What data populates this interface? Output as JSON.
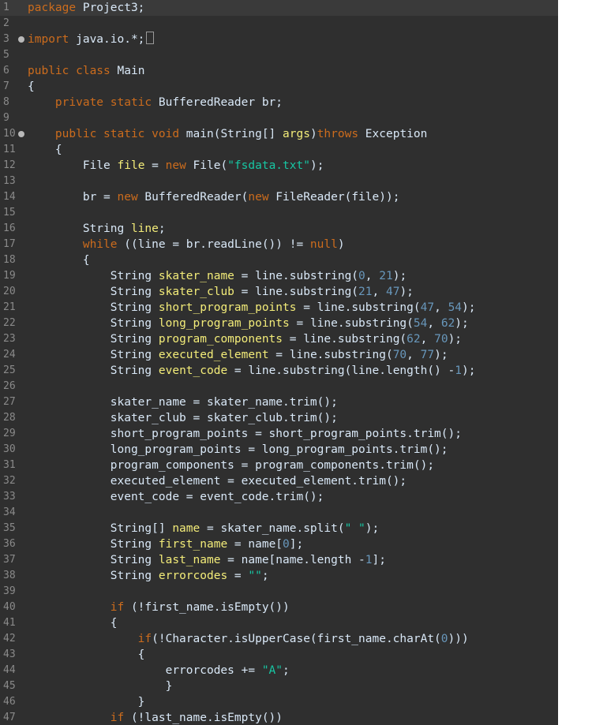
{
  "lines": [
    {
      "n": "1",
      "fold": false,
      "first": true,
      "tokens": [
        {
          "t": "package ",
          "c": "kw"
        },
        {
          "t": "Project3;",
          "c": "plain"
        }
      ]
    },
    {
      "n": "2",
      "fold": false,
      "tokens": []
    },
    {
      "n": "3",
      "fold": true,
      "tokens": [
        {
          "t": "import ",
          "c": "kw"
        },
        {
          "t": "java.io.*;",
          "c": "plain"
        }
      ],
      "box": true
    },
    {
      "n": "5",
      "fold": false,
      "tokens": []
    },
    {
      "n": "6",
      "fold": false,
      "tokens": [
        {
          "t": "public class ",
          "c": "kw"
        },
        {
          "t": "Main",
          "c": "plain"
        }
      ]
    },
    {
      "n": "7",
      "fold": false,
      "tokens": [
        {
          "t": "{",
          "c": "plain"
        }
      ]
    },
    {
      "n": "8",
      "fold": false,
      "tokens": [
        {
          "t": "    private static ",
          "c": "kw"
        },
        {
          "t": "BufferedReader br;",
          "c": "plain"
        }
      ]
    },
    {
      "n": "9",
      "fold": false,
      "tokens": []
    },
    {
      "n": "10",
      "fold": true,
      "tokens": [
        {
          "t": "    public static void ",
          "c": "kw"
        },
        {
          "t": "main",
          "c": "plain"
        },
        {
          "t": "(String[] ",
          "c": "plain"
        },
        {
          "t": "args",
          "c": "var"
        },
        {
          "t": ")",
          "c": "plain"
        },
        {
          "t": "throws ",
          "c": "kw"
        },
        {
          "t": "Exception",
          "c": "plain"
        }
      ]
    },
    {
      "n": "11",
      "fold": false,
      "tokens": [
        {
          "t": "    {",
          "c": "plain"
        }
      ]
    },
    {
      "n": "12",
      "fold": false,
      "tokens": [
        {
          "t": "        File ",
          "c": "plain"
        },
        {
          "t": "file",
          "c": "var"
        },
        {
          "t": " = ",
          "c": "plain"
        },
        {
          "t": "new ",
          "c": "kw"
        },
        {
          "t": "File(",
          "c": "plain"
        },
        {
          "t": "\"fsdata.txt\"",
          "c": "str"
        },
        {
          "t": ");",
          "c": "plain"
        }
      ]
    },
    {
      "n": "13",
      "fold": false,
      "tokens": []
    },
    {
      "n": "14",
      "fold": false,
      "tokens": [
        {
          "t": "        br = ",
          "c": "plain"
        },
        {
          "t": "new ",
          "c": "kw"
        },
        {
          "t": "BufferedReader(",
          "c": "plain"
        },
        {
          "t": "new ",
          "c": "kw"
        },
        {
          "t": "FileReader(file));",
          "c": "plain"
        }
      ]
    },
    {
      "n": "15",
      "fold": false,
      "tokens": []
    },
    {
      "n": "16",
      "fold": false,
      "tokens": [
        {
          "t": "        String ",
          "c": "plain"
        },
        {
          "t": "line",
          "c": "var"
        },
        {
          "t": ";",
          "c": "plain"
        }
      ]
    },
    {
      "n": "17",
      "fold": false,
      "tokens": [
        {
          "t": "        while ",
          "c": "kw"
        },
        {
          "t": "((line = br.readLine()) != ",
          "c": "plain"
        },
        {
          "t": "null",
          "c": "kw"
        },
        {
          "t": ")",
          "c": "plain"
        }
      ]
    },
    {
      "n": "18",
      "fold": false,
      "tokens": [
        {
          "t": "        {",
          "c": "plain"
        }
      ]
    },
    {
      "n": "19",
      "fold": false,
      "tokens": [
        {
          "t": "            String ",
          "c": "plain"
        },
        {
          "t": "skater_name",
          "c": "var"
        },
        {
          "t": " = line.substring(",
          "c": "plain"
        },
        {
          "t": "0",
          "c": "num"
        },
        {
          "t": ", ",
          "c": "plain"
        },
        {
          "t": "21",
          "c": "num"
        },
        {
          "t": ");",
          "c": "plain"
        }
      ]
    },
    {
      "n": "20",
      "fold": false,
      "tokens": [
        {
          "t": "            String ",
          "c": "plain"
        },
        {
          "t": "skater_club",
          "c": "var"
        },
        {
          "t": " = line.substring(",
          "c": "plain"
        },
        {
          "t": "21",
          "c": "num"
        },
        {
          "t": ", ",
          "c": "plain"
        },
        {
          "t": "47",
          "c": "num"
        },
        {
          "t": ");",
          "c": "plain"
        }
      ]
    },
    {
      "n": "21",
      "fold": false,
      "tokens": [
        {
          "t": "            String ",
          "c": "plain"
        },
        {
          "t": "short_program_points",
          "c": "var"
        },
        {
          "t": " = line.substring(",
          "c": "plain"
        },
        {
          "t": "47",
          "c": "num"
        },
        {
          "t": ", ",
          "c": "plain"
        },
        {
          "t": "54",
          "c": "num"
        },
        {
          "t": ");",
          "c": "plain"
        }
      ]
    },
    {
      "n": "22",
      "fold": false,
      "tokens": [
        {
          "t": "            String ",
          "c": "plain"
        },
        {
          "t": "long_program_points",
          "c": "var"
        },
        {
          "t": " = line.substring(",
          "c": "plain"
        },
        {
          "t": "54",
          "c": "num"
        },
        {
          "t": ", ",
          "c": "plain"
        },
        {
          "t": "62",
          "c": "num"
        },
        {
          "t": ");",
          "c": "plain"
        }
      ]
    },
    {
      "n": "23",
      "fold": false,
      "tokens": [
        {
          "t": "            String ",
          "c": "plain"
        },
        {
          "t": "program_components",
          "c": "var"
        },
        {
          "t": " = line.substring(",
          "c": "plain"
        },
        {
          "t": "62",
          "c": "num"
        },
        {
          "t": ", ",
          "c": "plain"
        },
        {
          "t": "70",
          "c": "num"
        },
        {
          "t": ");",
          "c": "plain"
        }
      ]
    },
    {
      "n": "24",
      "fold": false,
      "tokens": [
        {
          "t": "            String ",
          "c": "plain"
        },
        {
          "t": "executed_element",
          "c": "var"
        },
        {
          "t": " = line.substring(",
          "c": "plain"
        },
        {
          "t": "70",
          "c": "num"
        },
        {
          "t": ", ",
          "c": "plain"
        },
        {
          "t": "77",
          "c": "num"
        },
        {
          "t": ");",
          "c": "plain"
        }
      ]
    },
    {
      "n": "25",
      "fold": false,
      "tokens": [
        {
          "t": "            String ",
          "c": "plain"
        },
        {
          "t": "event_code",
          "c": "var"
        },
        {
          "t": " = line.substring(line.length() -",
          "c": "plain"
        },
        {
          "t": "1",
          "c": "num"
        },
        {
          "t": ");",
          "c": "plain"
        }
      ]
    },
    {
      "n": "26",
      "fold": false,
      "tokens": []
    },
    {
      "n": "27",
      "fold": false,
      "tokens": [
        {
          "t": "            skater_name = skater_name.trim();",
          "c": "plain"
        }
      ]
    },
    {
      "n": "28",
      "fold": false,
      "tokens": [
        {
          "t": "            skater_club = skater_club.trim();",
          "c": "plain"
        }
      ]
    },
    {
      "n": "29",
      "fold": false,
      "tokens": [
        {
          "t": "            short_program_points = short_program_points.trim();",
          "c": "plain"
        }
      ]
    },
    {
      "n": "30",
      "fold": false,
      "tokens": [
        {
          "t": "            long_program_points = long_program_points.trim();",
          "c": "plain"
        }
      ]
    },
    {
      "n": "31",
      "fold": false,
      "tokens": [
        {
          "t": "            program_components = program_components.trim();",
          "c": "plain"
        }
      ]
    },
    {
      "n": "32",
      "fold": false,
      "tokens": [
        {
          "t": "            executed_element = executed_element.trim();",
          "c": "plain"
        }
      ]
    },
    {
      "n": "33",
      "fold": false,
      "tokens": [
        {
          "t": "            event_code = event_code.trim();",
          "c": "plain"
        }
      ]
    },
    {
      "n": "34",
      "fold": false,
      "tokens": []
    },
    {
      "n": "35",
      "fold": false,
      "tokens": [
        {
          "t": "            String[] ",
          "c": "plain"
        },
        {
          "t": "name",
          "c": "var"
        },
        {
          "t": " = skater_name.split(",
          "c": "plain"
        },
        {
          "t": "\" \"",
          "c": "str"
        },
        {
          "t": ");",
          "c": "plain"
        }
      ]
    },
    {
      "n": "36",
      "fold": false,
      "tokens": [
        {
          "t": "            String ",
          "c": "plain"
        },
        {
          "t": "first_name",
          "c": "var"
        },
        {
          "t": " = name[",
          "c": "plain"
        },
        {
          "t": "0",
          "c": "num"
        },
        {
          "t": "];",
          "c": "plain"
        }
      ]
    },
    {
      "n": "37",
      "fold": false,
      "tokens": [
        {
          "t": "            String ",
          "c": "plain"
        },
        {
          "t": "last_name",
          "c": "var"
        },
        {
          "t": " = name[name.length -",
          "c": "plain"
        },
        {
          "t": "1",
          "c": "num"
        },
        {
          "t": "];",
          "c": "plain"
        }
      ]
    },
    {
      "n": "38",
      "fold": false,
      "tokens": [
        {
          "t": "            String ",
          "c": "plain"
        },
        {
          "t": "errorcodes",
          "c": "var"
        },
        {
          "t": " = ",
          "c": "plain"
        },
        {
          "t": "\"\"",
          "c": "str"
        },
        {
          "t": ";",
          "c": "plain"
        }
      ]
    },
    {
      "n": "39",
      "fold": false,
      "tokens": []
    },
    {
      "n": "40",
      "fold": false,
      "tokens": [
        {
          "t": "            if ",
          "c": "kw"
        },
        {
          "t": "(!first_name.isEmpty())",
          "c": "plain"
        }
      ]
    },
    {
      "n": "41",
      "fold": false,
      "tokens": [
        {
          "t": "            {",
          "c": "plain"
        }
      ]
    },
    {
      "n": "42",
      "fold": false,
      "tokens": [
        {
          "t": "                if",
          "c": "kw"
        },
        {
          "t": "(!Character.isUpperCase(first_name.charAt(",
          "c": "plain"
        },
        {
          "t": "0",
          "c": "num"
        },
        {
          "t": ")))",
          "c": "plain"
        }
      ]
    },
    {
      "n": "43",
      "fold": false,
      "tokens": [
        {
          "t": "                {",
          "c": "plain"
        }
      ]
    },
    {
      "n": "44",
      "fold": false,
      "tokens": [
        {
          "t": "                    errorcodes += ",
          "c": "plain"
        },
        {
          "t": "\"A\"",
          "c": "str"
        },
        {
          "t": ";",
          "c": "plain"
        }
      ]
    },
    {
      "n": "45",
      "fold": false,
      "tokens": [
        {
          "t": "                    }",
          "c": "plain"
        }
      ]
    },
    {
      "n": "46",
      "fold": false,
      "tokens": [
        {
          "t": "                }",
          "c": "plain"
        }
      ]
    },
    {
      "n": "47",
      "fold": false,
      "tokens": [
        {
          "t": "            if ",
          "c": "kw"
        },
        {
          "t": "(!last_name.isEmpty())",
          "c": "plain"
        }
      ]
    }
  ],
  "colors": {
    "background": "#2f2f2f",
    "keyword": "#cc6c1d",
    "variable": "#f3ec79",
    "string": "#17c6a3",
    "number": "#6897bb",
    "text": "#d9e8f7",
    "line_number": "#8a8a8a"
  }
}
